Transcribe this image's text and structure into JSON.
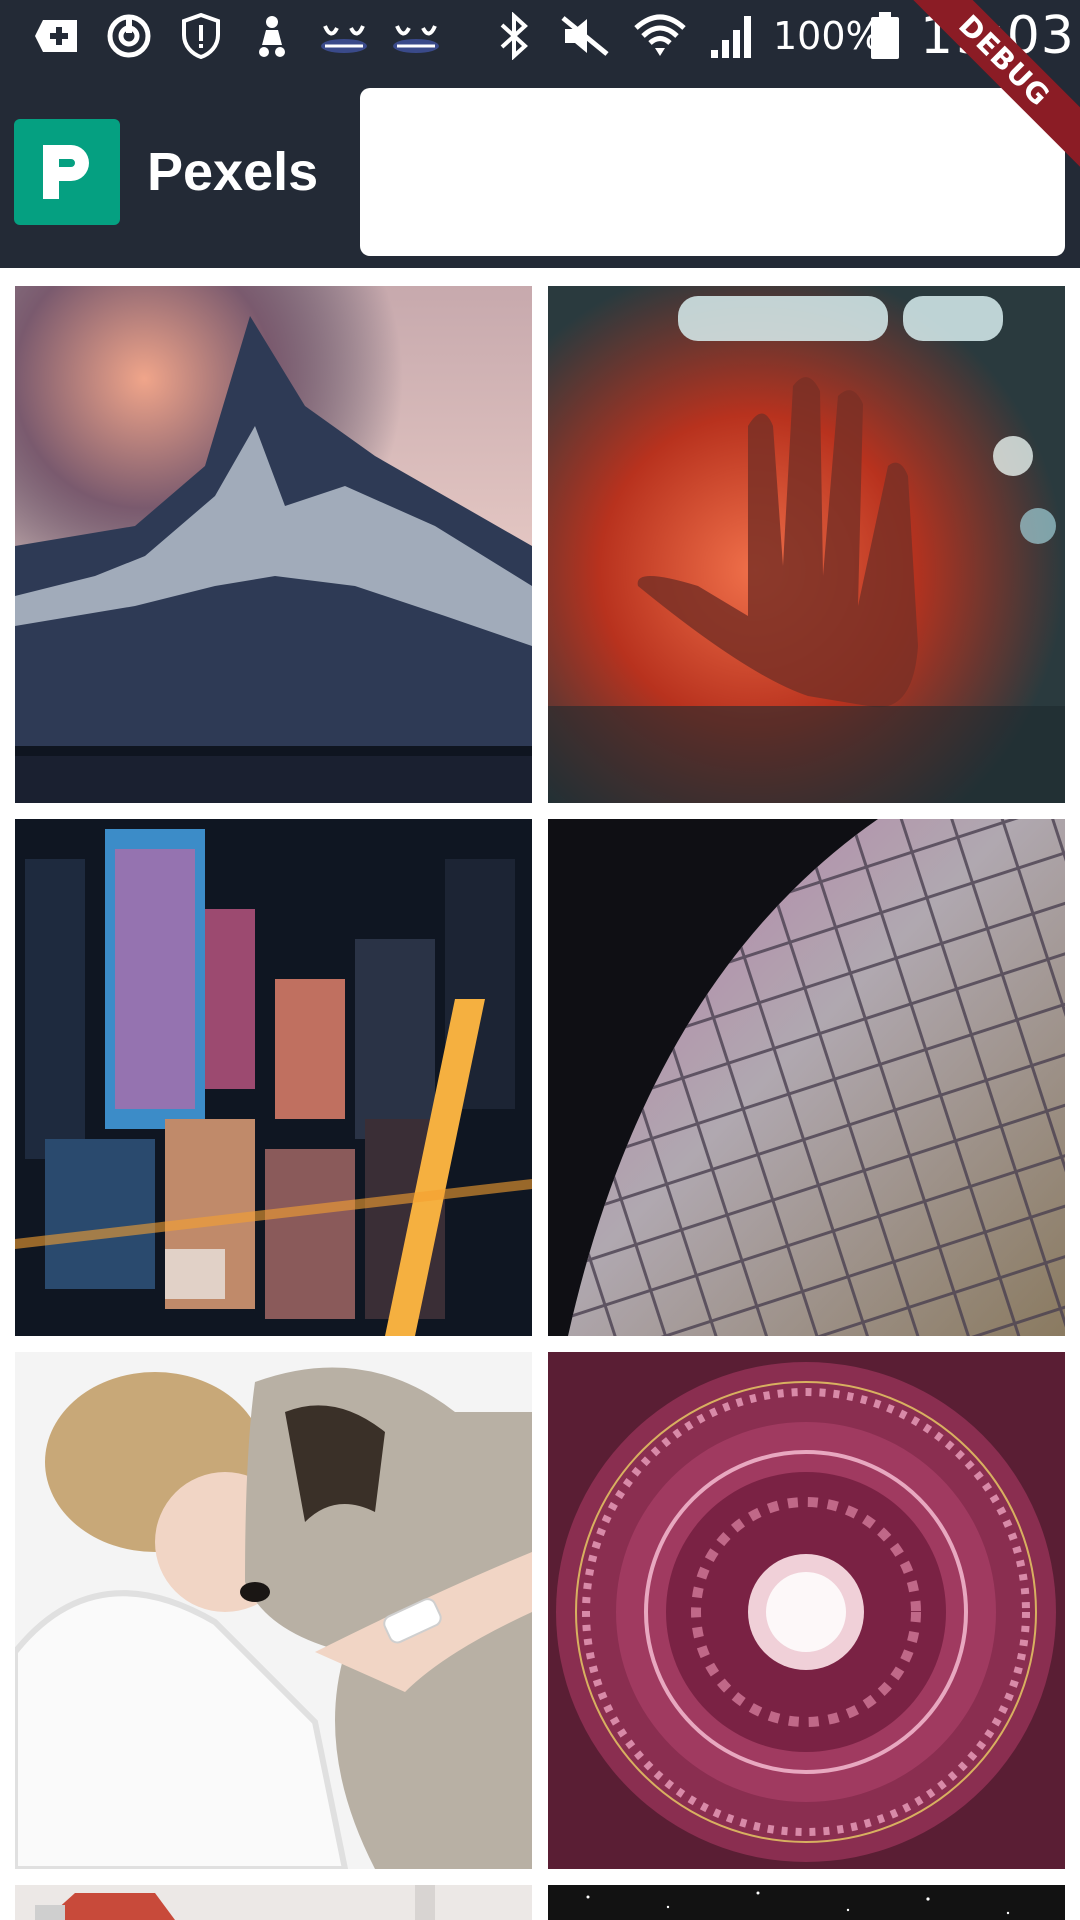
{
  "status_bar": {
    "icons": [
      "add-box-icon",
      "sync-icon",
      "shield-alert-icon",
      "stroller-icon",
      "cat-icon",
      "cat-icon",
      "bluetooth-icon",
      "mute-icon",
      "wifi-icon",
      "signal-icon"
    ],
    "battery_percent": "100%",
    "time": "19:03"
  },
  "app_bar": {
    "logo_icon": "pexels-logo-icon",
    "title": "Pexels",
    "brand_color": "#05a081",
    "background_color": "#232a36",
    "search": {
      "value": "",
      "placeholder": ""
    }
  },
  "debug_banner": "DEBUG",
  "photos": [
    {
      "subject": "mountain-peak"
    },
    {
      "subject": "hand-on-glass"
    },
    {
      "subject": "city-night-aerial"
    },
    {
      "subject": "dome-facade"
    },
    {
      "subject": "woman-with-dog"
    },
    {
      "subject": "ornate-ceiling"
    },
    {
      "subject": "rooftop"
    },
    {
      "subject": "starry-sky"
    }
  ]
}
